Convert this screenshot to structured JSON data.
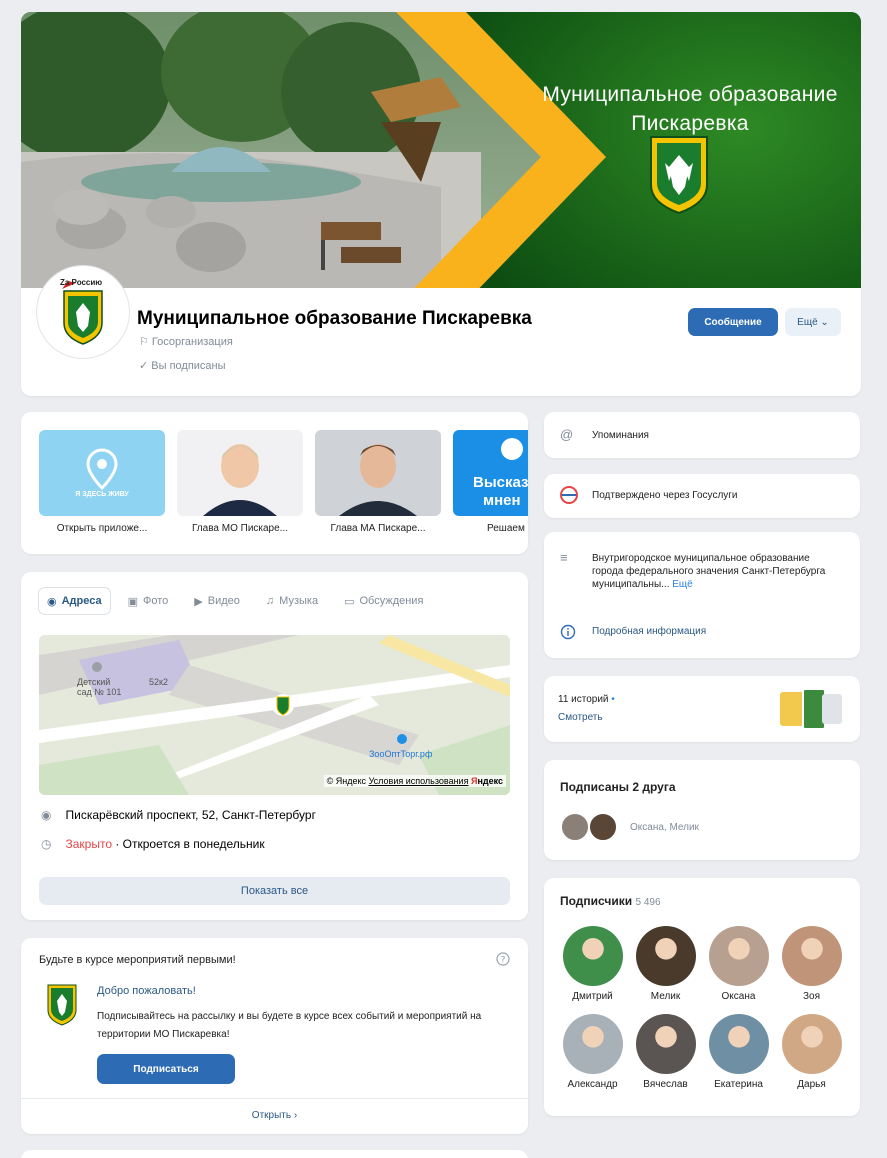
{
  "cover": {
    "title_line1": "Муниципальное образование",
    "title_line2": "Пискаревка"
  },
  "header": {
    "title": "Муниципальное образование Пискаревка",
    "type": "Госорганизация",
    "subscribed": "Вы подписаны",
    "avatar_text": "Zа Россию",
    "message_button": "Сообщение",
    "more_button": "Ещё"
  },
  "links": [
    {
      "caption": "Открыть приложе...",
      "image_text": "Я ЗДЕСЬ ЖИВУ"
    },
    {
      "caption": "Глава МО Пискаре..."
    },
    {
      "caption": "Глава МА Пискаре..."
    },
    {
      "caption": "Решаем в",
      "image_text_1": "Высказ",
      "image_text_2": "мнен"
    }
  ],
  "tabs": [
    {
      "label": "Адреса",
      "icon": "location-pin-icon"
    },
    {
      "label": "Фото",
      "icon": "photo-icon"
    },
    {
      "label": "Видео",
      "icon": "video-icon"
    },
    {
      "label": "Музыка",
      "icon": "music-icon"
    },
    {
      "label": "Обсуждения",
      "icon": "chat-icon"
    }
  ],
  "map": {
    "label_kindergarten_1": "Детский",
    "label_kindergarten_2": "сад № 101",
    "label_building": "52к2",
    "label_shop": "ЗооОптТорг.рф",
    "credit_yandex": "© Яндекс",
    "credit_terms": "Условия использования",
    "credit_logo_y": "Я",
    "credit_logo_rest": "ндекс"
  },
  "address": {
    "street": "Пискарёвский проспект, 52, Санкт-Петербург",
    "status_closed": "Закрыто",
    "status_opens": " · Откроется в понедельник",
    "show_all": "Показать все"
  },
  "events": {
    "heading": "Будьте в курсе мероприятий первыми!",
    "welcome": "Добро пожаловать!",
    "text": "Подписывайтесь на рассылку и вы будете в курсе всех событий и мероприятий на территории МО Пискаревка!",
    "subscribe_button": "Подписаться",
    "open_link": "Открыть ›"
  },
  "sidebar": {
    "mentions": "Упоминания",
    "verified": "Подтверждено через Госуслуги",
    "description": "Внутригородское муниципальное образование города федерального значения Санкт-Петербурга муниципальны...",
    "description_more": "Ещё",
    "details": "Подробная информация",
    "stories_count": "11 историй",
    "stories_watch": "Смотреть",
    "friends_title": "Подписаны 2 друга",
    "friends_names": "Оксана, Мелик",
    "subscribers_title": "Подписчики",
    "subscribers_count": "5 496",
    "subscribers": [
      {
        "name": "Дмитрий",
        "color": "#3f8f4a"
      },
      {
        "name": "Мелик",
        "color": "#4a3a2c"
      },
      {
        "name": "Оксана",
        "color": "#b8a090"
      },
      {
        "name": "Зоя",
        "color": "#c09478"
      },
      {
        "name": "Александр",
        "color": "#a8b0b8"
      },
      {
        "name": "Вячеслав",
        "color": "#5a5452"
      },
      {
        "name": "Екатерина",
        "color": "#6f8fa4"
      },
      {
        "name": "Дарья",
        "color": "#d0a886"
      }
    ]
  },
  "colors": {
    "accent": "#2d6cb4",
    "link": "#2a5885",
    "closed": "#e64646",
    "cover_green": "#1f7a22",
    "cover_orange": "#f9a20e"
  }
}
